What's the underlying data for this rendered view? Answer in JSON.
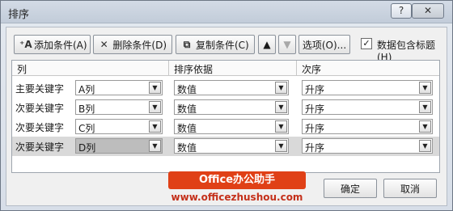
{
  "dialog": {
    "title": "排序",
    "help_label": "?",
    "close_label": "✕"
  },
  "toolbar": {
    "add_label": "添加条件(A)",
    "delete_label": "删除条件(D)",
    "copy_label": "复制条件(C)",
    "up_label": "▲",
    "down_label": "▼",
    "options_label": "选项(O)...",
    "header_checkbox_label": "数据包含标题(H)",
    "header_checkbox_checked": "✓"
  },
  "columns": {
    "column": "列",
    "sort_on": "排序依据",
    "order": "次序"
  },
  "rows": [
    {
      "label": "主要关键字",
      "column": "A列",
      "sort_on": "数值",
      "order": "升序"
    },
    {
      "label": "次要关键字",
      "column": "B列",
      "sort_on": "数值",
      "order": "升序"
    },
    {
      "label": "次要关键字",
      "column": "C列",
      "sort_on": "数值",
      "order": "升序"
    },
    {
      "label": "次要关键字",
      "column": "D列",
      "sort_on": "数值",
      "order": "升序"
    }
  ],
  "footer": {
    "ok_label": "确定",
    "cancel_label": "取消"
  },
  "watermark": {
    "title": "Office办公助手",
    "url": "www.officezhushou.com"
  }
}
